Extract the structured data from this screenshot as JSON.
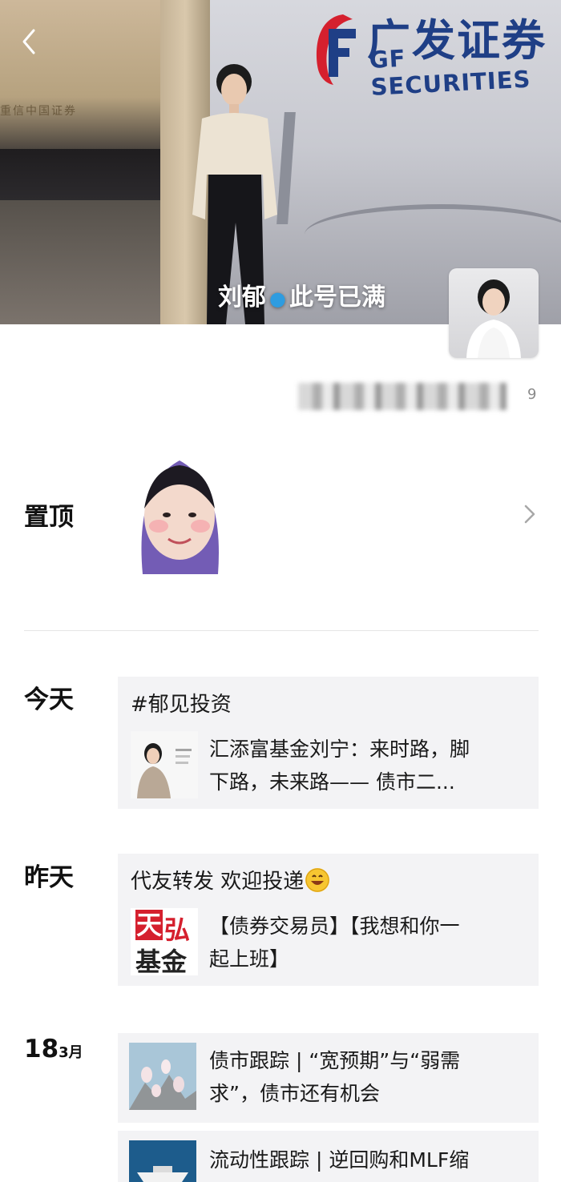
{
  "cover": {
    "logo_cn": "广发证券",
    "logo_en": "GF SECURITIES",
    "hall_sign": "重信中国证券",
    "name_left": "刘郁",
    "name_right": "此号已满"
  },
  "signature": {
    "count": "9"
  },
  "sections": {
    "pinned": {
      "label": "置顶"
    },
    "today": {
      "label": "今天",
      "card": {
        "text": "#郁见投资",
        "title_line1": "汇添富基金刘宁：来时路，脚",
        "title_line2": "下路，未来路—— 债市二..."
      }
    },
    "yesterday": {
      "label": "昨天",
      "card": {
        "text": "代友转发 欢迎投递",
        "brand_top_left": "天",
        "brand_top_right": "弘",
        "brand_bottom": "基金",
        "title_line1": "【债券交易员】【我想和你一",
        "title_line2": "起上班】"
      }
    },
    "march18": {
      "day": "18",
      "month": "3月",
      "cards": [
        {
          "title_line1": "债市跟踪 | “宽预期”与“弱需",
          "title_line2": "求”，债市还有机会"
        },
        {
          "title_line1": "流动性跟踪 | 逆回购和MLF缩"
        }
      ]
    }
  },
  "icons": {
    "back": "chevron-left-icon",
    "more": "chevron-right-icon"
  },
  "colors": {
    "brand_blue": "#1f3f86",
    "brand_red": "#d5202e",
    "card_bg": "#f3f3f5"
  }
}
